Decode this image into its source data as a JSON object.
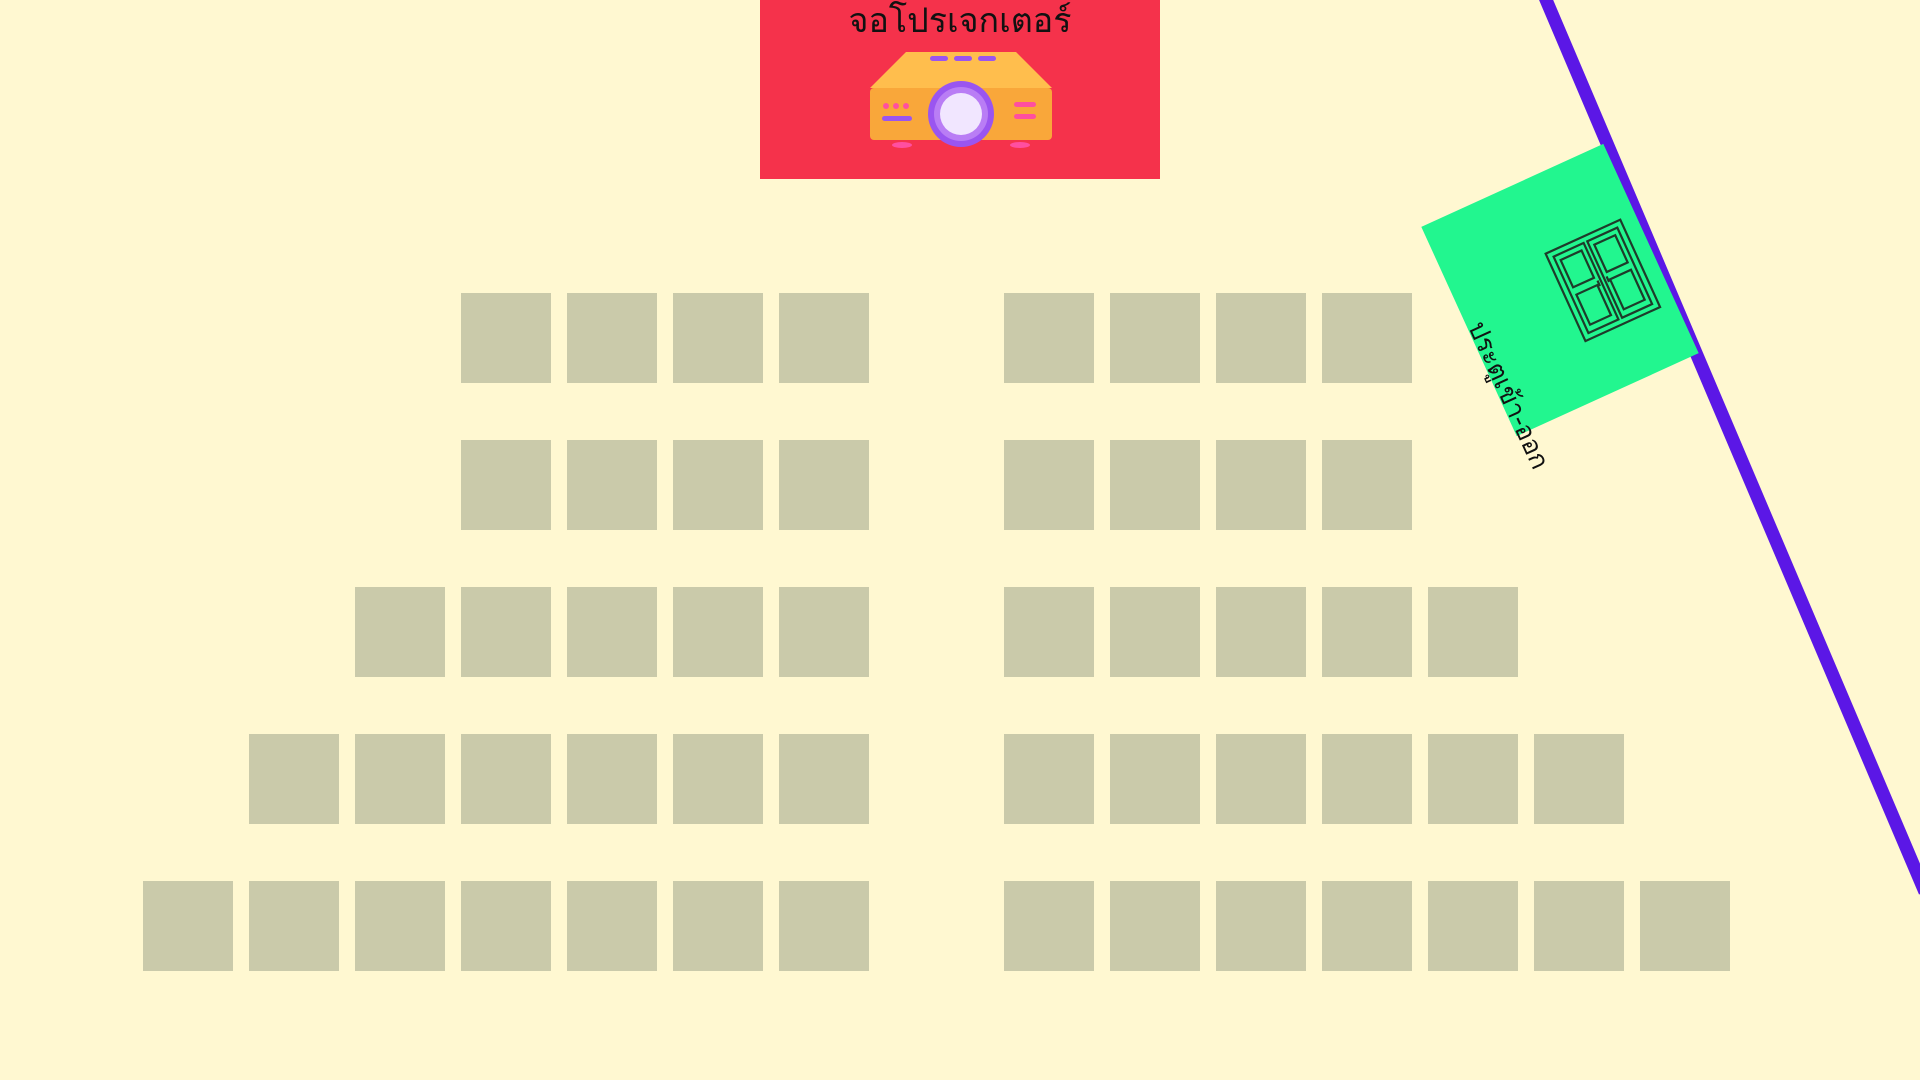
{
  "screen": {
    "label": "จอโปรเจกเตอร์",
    "icon": "projector-icon",
    "color": "#f5324b"
  },
  "door": {
    "label": "ประตูเข้า-ออก",
    "icon": "double-door-icon",
    "color": "#22f68f"
  },
  "wall": {
    "color": "#5b17e6"
  },
  "seat_color": "#cacaaa",
  "background": "#fff8d1",
  "seating": {
    "left_block": {
      "rows": [
        4,
        4,
        5,
        6,
        7
      ]
    },
    "right_block": {
      "rows": [
        4,
        4,
        5,
        6,
        7
      ]
    }
  }
}
